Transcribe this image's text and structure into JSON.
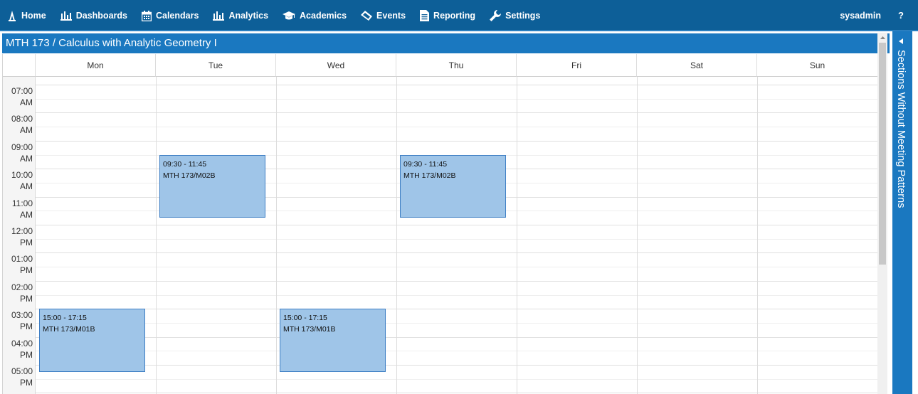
{
  "nav": {
    "items": [
      {
        "label": "Home",
        "icon": "home-icon"
      },
      {
        "label": "Dashboards",
        "icon": "bar-chart-icon"
      },
      {
        "label": "Calendars",
        "icon": "calendar-icon"
      },
      {
        "label": "Analytics",
        "icon": "bar-chart-icon"
      },
      {
        "label": "Academics",
        "icon": "graduation-cap-icon"
      },
      {
        "label": "Events",
        "icon": "ticket-icon"
      },
      {
        "label": "Reporting",
        "icon": "document-icon"
      },
      {
        "label": "Settings",
        "icon": "wrench-icon"
      }
    ],
    "user": "sysadmin",
    "help": "?"
  },
  "page": {
    "title": "MTH 173 / Calculus with Analytic Geometry I"
  },
  "calendar": {
    "days": [
      "Mon",
      "Tue",
      "Wed",
      "Thu",
      "Fri",
      "Sat",
      "Sun"
    ],
    "times": [
      {
        "h": "07:00",
        "p": "AM"
      },
      {
        "h": "08:00",
        "p": "AM"
      },
      {
        "h": "09:00",
        "p": "AM"
      },
      {
        "h": "10:00",
        "p": "AM"
      },
      {
        "h": "11:00",
        "p": "AM"
      },
      {
        "h": "12:00",
        "p": "PM"
      },
      {
        "h": "01:00",
        "p": "PM"
      },
      {
        "h": "02:00",
        "p": "PM"
      },
      {
        "h": "03:00",
        "p": "PM"
      },
      {
        "h": "04:00",
        "p": "PM"
      },
      {
        "h": "05:00",
        "p": "PM"
      }
    ],
    "events": [
      {
        "day": 1,
        "start": "09:30",
        "end": "11:45",
        "time": "09:30 - 11:45",
        "section": "MTH 173/M02B"
      },
      {
        "day": 3,
        "start": "09:30",
        "end": "11:45",
        "time": "09:30 - 11:45",
        "section": "MTH 173/M02B"
      },
      {
        "day": 0,
        "start": "15:00",
        "end": "17:15",
        "time": "15:00 - 17:15",
        "section": "MTH 173/M01B"
      },
      {
        "day": 2,
        "start": "15:00",
        "end": "17:15",
        "time": "15:00 - 17:15",
        "section": "MTH 173/M01B"
      }
    ]
  },
  "side_panel": {
    "label": "Sections Without Meeting Patterns"
  },
  "colors": {
    "nav_bg": "#0d5f98",
    "title_bg": "#1a78c0",
    "event_bg": "#9fc5e8",
    "event_border": "#3f7fc4"
  }
}
